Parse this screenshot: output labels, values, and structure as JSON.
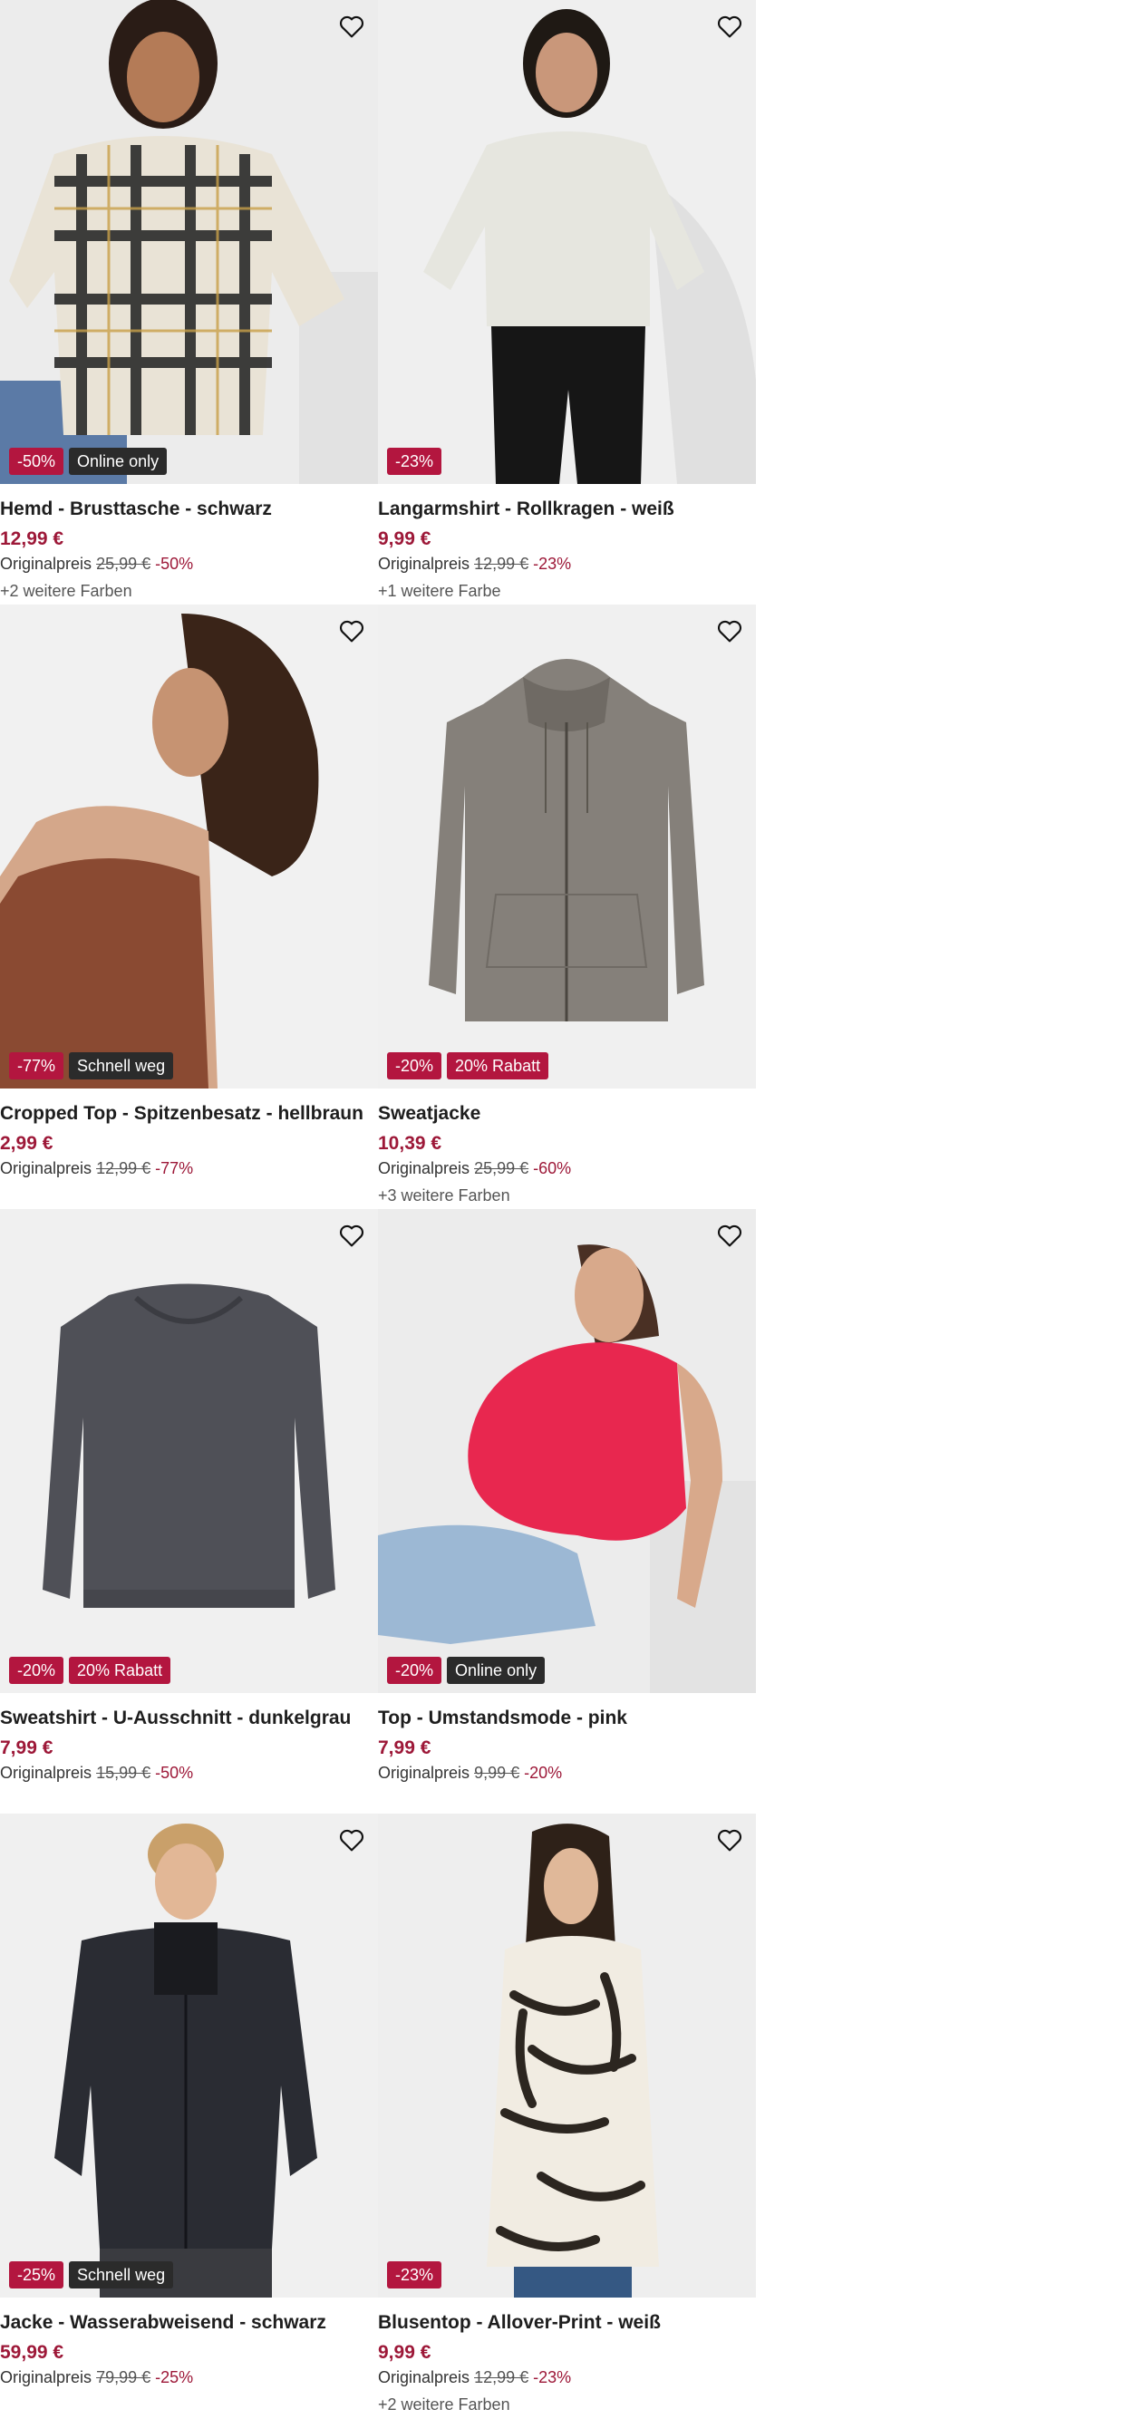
{
  "accent_color": "#9d1838",
  "badge_colors": {
    "discount": "#b3163f",
    "dark": "#2b2b2b"
  },
  "products": [
    {
      "title": "Hemd - Brusttasche - schwarz",
      "price": "12,99 €",
      "orig_label": "Originalpreis",
      "orig_price": "25,99 €",
      "orig_pct": "-50%",
      "colors": "+2 weitere Farben",
      "badges": [
        {
          "text": "-50%",
          "type": "discount"
        },
        {
          "text": "Online only",
          "type": "dark"
        }
      ],
      "image": "woman-plaid-shirt"
    },
    {
      "title": "Langarmshirt - Rollkragen - weiß",
      "price": "9,99 €",
      "orig_label": "Originalpreis",
      "orig_price": "12,99 €",
      "orig_pct": "-23%",
      "colors": "+1 weitere Farbe",
      "badges": [
        {
          "text": "-23%",
          "type": "discount"
        }
      ],
      "image": "woman-white-turtleneck"
    },
    {
      "title": "Cropped Top - Spitzenbesatz - hellbraun",
      "price": "2,99 €",
      "orig_label": "Originalpreis",
      "orig_price": "12,99 €",
      "orig_pct": "-77%",
      "colors": "",
      "badges": [
        {
          "text": "-77%",
          "type": "discount"
        },
        {
          "text": "Schnell weg",
          "type": "dark"
        }
      ],
      "image": "woman-brown-top"
    },
    {
      "title": "Sweatjacke",
      "price": "10,39 €",
      "orig_label": "Originalpreis",
      "orig_price": "25,99 €",
      "orig_pct": "-60%",
      "colors": "+3 weitere Farben",
      "badges": [
        {
          "text": "-20%",
          "type": "discount"
        },
        {
          "text": "20% Rabatt",
          "type": "promo"
        }
      ],
      "image": "olive-hoodie"
    },
    {
      "title": "Sweatshirt - U-Ausschnitt - dunkelgrau",
      "price": "7,99 €",
      "orig_label": "Originalpreis",
      "orig_price": "15,99 €",
      "orig_pct": "-50%",
      "colors": "",
      "badges": [
        {
          "text": "-20%",
          "type": "discount"
        },
        {
          "text": "20% Rabatt",
          "type": "promo"
        }
      ],
      "image": "grey-sweatshirt"
    },
    {
      "title": "Top - Umstandsmode - pink",
      "price": "7,99 €",
      "orig_label": "Originalpreis",
      "orig_price": "9,99 €",
      "orig_pct": "-20%",
      "colors": "",
      "badges": [
        {
          "text": "-20%",
          "type": "discount"
        },
        {
          "text": "Online only",
          "type": "dark"
        }
      ],
      "image": "pregnant-woman-pink-top"
    },
    {
      "title": "Jacke - Wasserabweisend - schwarz",
      "price": "59,99 €",
      "orig_label": "Originalpreis",
      "orig_price": "79,99 €",
      "orig_pct": "-25%",
      "colors": "",
      "badges": [
        {
          "text": "-25%",
          "type": "discount"
        },
        {
          "text": "Schnell weg",
          "type": "dark"
        }
      ],
      "image": "man-black-jacket"
    },
    {
      "title": "Blusentop - Allover-Print - weiß",
      "price": "9,99 €",
      "orig_label": "Originalpreis",
      "orig_price": "12,99 €",
      "orig_pct": "-23%",
      "colors": "+2 weitere Farben",
      "badges": [
        {
          "text": "-23%",
          "type": "discount"
        }
      ],
      "image": "woman-leaf-print-top"
    }
  ]
}
